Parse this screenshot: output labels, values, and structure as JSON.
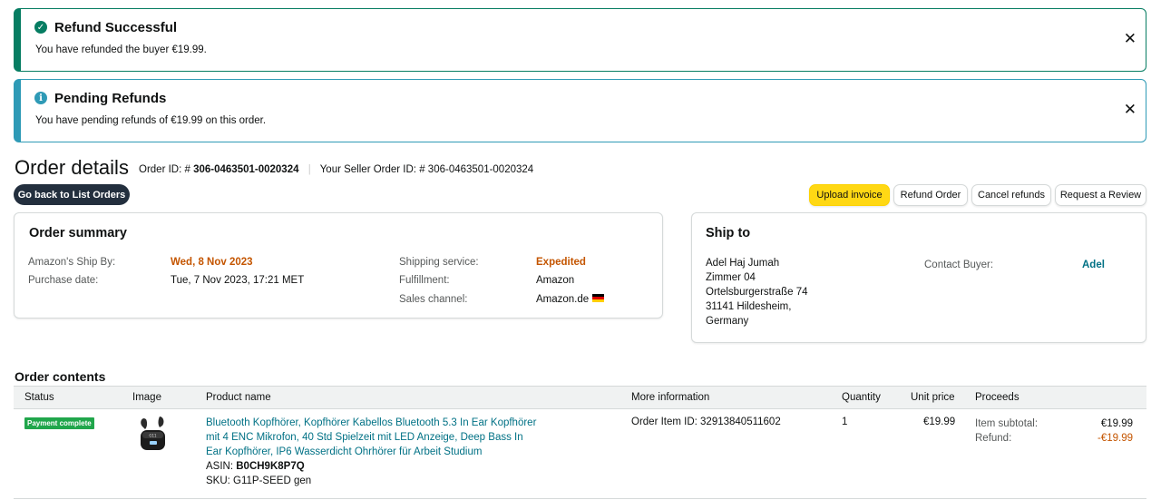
{
  "alerts": {
    "success": {
      "title": "Refund Successful",
      "body": "You have refunded the buyer €19.99.",
      "icon": "check-circle-icon",
      "close": "✕"
    },
    "info": {
      "title": "Pending Refunds",
      "body": "You have pending refunds of €19.99 on this order.",
      "icon": "info-circle-icon",
      "close": "✕"
    }
  },
  "header": {
    "title": "Order details",
    "order_id_label": "Order ID: #",
    "order_id": "306-0463501-0020324",
    "seller_order_id_label": "Your Seller Order ID: #",
    "seller_order_id": "306-0463501-0020324"
  },
  "actions": {
    "back": "Go back to List Orders",
    "upload_invoice": "Upload invoice",
    "refund_order": "Refund Order",
    "cancel_refunds": "Cancel refunds",
    "request_review": "Request a Review"
  },
  "order_summary": {
    "title": "Order summary",
    "ship_by_label": "Amazon's Ship By:",
    "ship_by": "Wed, 8 Nov 2023",
    "purchase_date_label": "Purchase date:",
    "purchase_date": "Tue, 7 Nov 2023, 17:21 MET",
    "shipping_service_label": "Shipping service:",
    "shipping_service": "Expedited",
    "fulfillment_label": "Fulfillment:",
    "fulfillment": "Amazon",
    "sales_channel_label": "Sales channel:",
    "sales_channel": "Amazon.de"
  },
  "ship_to": {
    "title": "Ship to",
    "name": "Adel Haj Jumah",
    "line1": "Zimmer 04",
    "line2": "Ortelsburgerstraße 74",
    "line3": "31141 Hildesheim,",
    "country": "Germany",
    "contact_label": "Contact Buyer:",
    "contact_name": "Adel"
  },
  "order_contents": {
    "title": "Order contents",
    "columns": [
      "Status",
      "Image",
      "Product name",
      "More information",
      "Quantity",
      "Unit price",
      "Proceeds"
    ],
    "row": {
      "status": "Payment complete",
      "product_name": "Bluetooth Kopfhörer, Kopfhörer Kabellos Bluetooth 5.3 In Ear Kopfhörer mit 4 ENC Mikrofon, 40 Std Spielzeit mit LED Anzeige, Deep Bass In Ear Kopfhörer, IP6 Wasserdicht Ohrhörer für Arbeit Studium",
      "asin_label": "ASIN:",
      "asin": "B0CH9K8P7Q",
      "sku_label": "SKU:",
      "sku": "G11P-SEED gen",
      "more_info": "Order Item ID: 32913840511602",
      "quantity": "1",
      "unit_price": "€19.99",
      "item_subtotal_label": "Item subtotal:",
      "item_subtotal": "€19.99",
      "refund_label": "Refund:",
      "refund": "-€19.99"
    }
  }
}
